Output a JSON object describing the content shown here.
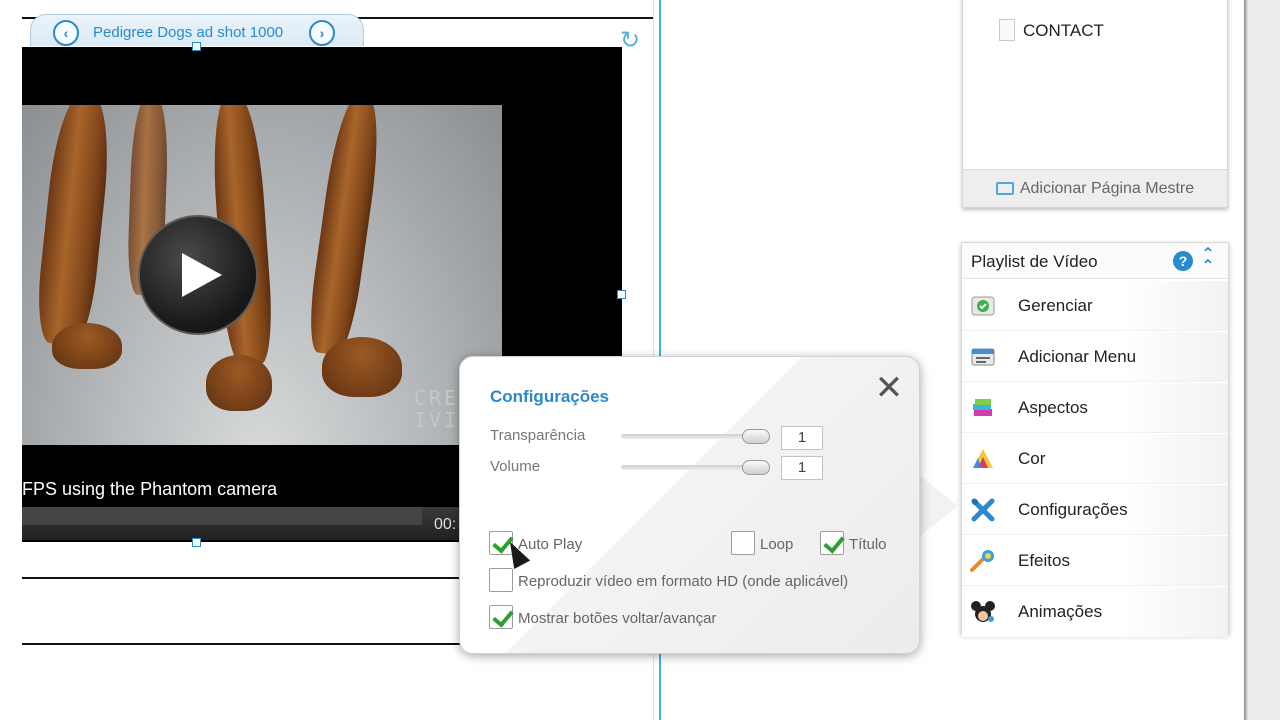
{
  "canvas": {
    "tab_title": "Pedigree Dogs ad shot 1000",
    "video": {
      "caption": "FPS using the Phantom camera",
      "time": "00:",
      "watermark": "CRE\nIVI"
    }
  },
  "pages_panel": {
    "items": [
      {
        "label": "CONTACT"
      }
    ],
    "add_master_label": "Adicionar Página Mestre"
  },
  "playlist_panel": {
    "title": "Playlist de Vídeo",
    "items": [
      {
        "label": "Gerenciar",
        "icon": "manage-icon"
      },
      {
        "label": "Adicionar Menu",
        "icon": "add-menu-icon"
      },
      {
        "label": "Aspectos",
        "icon": "aspects-icon"
      },
      {
        "label": "Cor",
        "icon": "color-icon"
      },
      {
        "label": "Configurações",
        "icon": "settings-icon"
      },
      {
        "label": "Efeitos",
        "icon": "effects-icon"
      },
      {
        "label": "Animações",
        "icon": "animations-icon"
      }
    ]
  },
  "settings_popup": {
    "title": "Configurações",
    "sliders": [
      {
        "label": "Transparência",
        "value": "1"
      },
      {
        "label": "Volume",
        "value": "1"
      }
    ],
    "checkboxes": {
      "autoplay": {
        "label": "Auto Play",
        "checked": true
      },
      "loop": {
        "label": "Loop",
        "checked": false
      },
      "titulo": {
        "label": "Título",
        "checked": true
      },
      "hd": {
        "label": "Reproduzir vídeo em formato HD (onde aplicável)",
        "checked": false
      },
      "nav_buttons": {
        "label": "Mostrar botões voltar/avançar",
        "checked": true
      }
    }
  },
  "colors": {
    "accent": "#2a8ac9",
    "guide": "#3fb3dc",
    "check": "#2e9e2e"
  }
}
